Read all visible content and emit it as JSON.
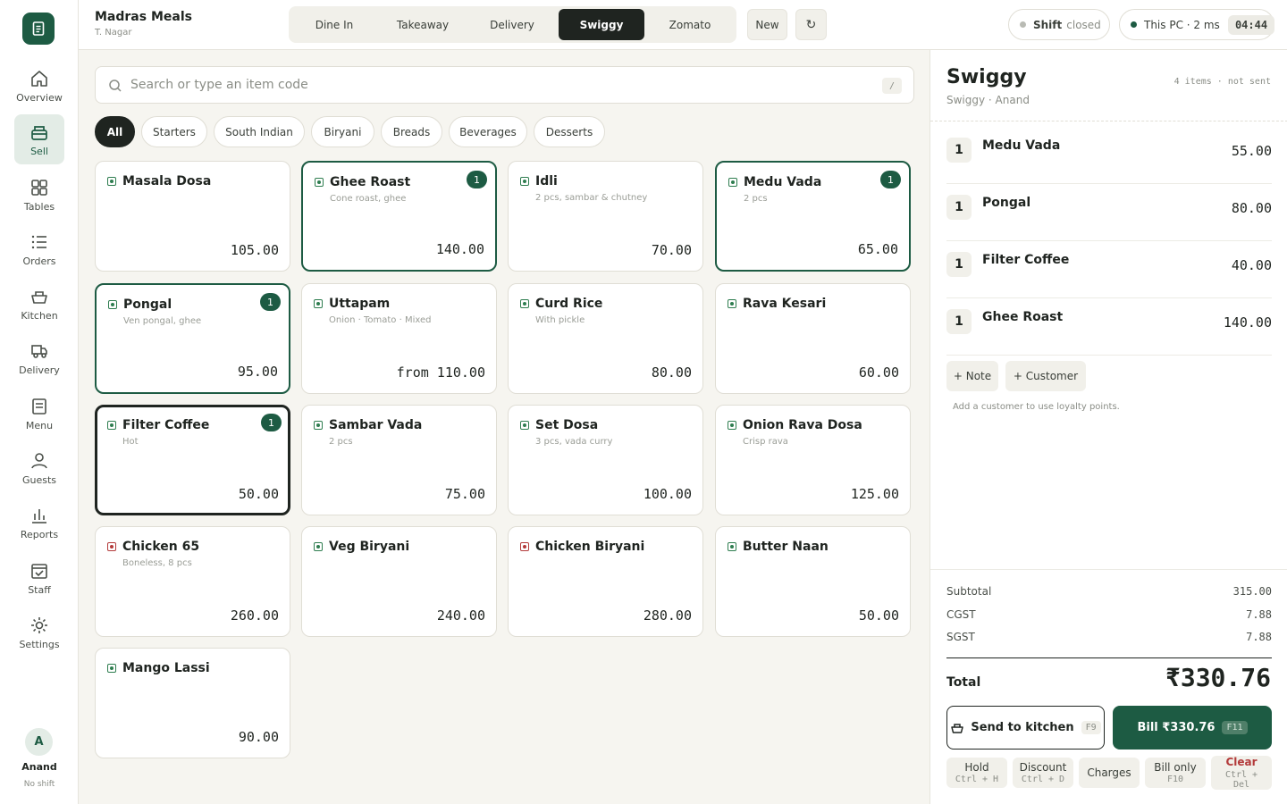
{
  "brand": {
    "name": "Madras Meals",
    "location": "T. Nagar"
  },
  "order_types": [
    "Dine In",
    "Takeaway",
    "Delivery",
    "Swiggy",
    "Zomato"
  ],
  "active_order_type": "Swiggy",
  "new_label": "New",
  "refresh_icon": "↻",
  "shift": {
    "label": "Shift",
    "status": "closed"
  },
  "connection": {
    "label": "This PC · 2 ms"
  },
  "clock": "04:44",
  "nav": [
    {
      "label": "Overview",
      "icon": "home-icon"
    },
    {
      "label": "Sell",
      "icon": "register-icon",
      "active": true
    },
    {
      "label": "Tables",
      "icon": "grid-icon"
    },
    {
      "label": "Orders",
      "icon": "list-icon"
    },
    {
      "label": "Kitchen",
      "icon": "pot-icon"
    },
    {
      "label": "Delivery",
      "icon": "truck-icon"
    },
    {
      "label": "Menu",
      "icon": "menu-icon"
    },
    {
      "label": "Guests",
      "icon": "user-icon"
    },
    {
      "label": "Reports",
      "icon": "chart-icon"
    },
    {
      "label": "Staff",
      "icon": "calendar-icon"
    },
    {
      "label": "Settings",
      "icon": "gear-icon"
    }
  ],
  "user": {
    "initial": "A",
    "name": "Anand",
    "shift": "No shift"
  },
  "search": {
    "placeholder": "Search or type an item code",
    "shortcut": "/"
  },
  "categories": [
    "All",
    "Starters",
    "South Indian",
    "Biryani",
    "Breads",
    "Beverages",
    "Desserts"
  ],
  "active_category": "All",
  "items": [
    {
      "name": "Masala Dosa",
      "desc": "",
      "price": "105.00",
      "veg": true,
      "qty": ""
    },
    {
      "name": "Ghee Roast",
      "desc": "Cone roast, ghee",
      "price": "140.00",
      "veg": true,
      "qty": "1"
    },
    {
      "name": "Idli",
      "desc": "2 pcs, sambar & chutney",
      "price": "70.00",
      "veg": true,
      "qty": ""
    },
    {
      "name": "Medu Vada",
      "desc": "2 pcs",
      "price": "65.00",
      "veg": true,
      "qty": "1"
    },
    {
      "name": "Pongal",
      "desc": "Ven pongal, ghee",
      "price": "95.00",
      "veg": true,
      "qty": "1"
    },
    {
      "name": "Uttapam",
      "desc": "Onion · Tomato · Mixed",
      "price": "from 110.00",
      "veg": true,
      "qty": ""
    },
    {
      "name": "Curd Rice",
      "desc": "With pickle",
      "price": "80.00",
      "veg": true,
      "qty": ""
    },
    {
      "name": "Rava Kesari",
      "desc": "",
      "price": "60.00",
      "veg": true,
      "qty": ""
    },
    {
      "name": "Filter Coffee",
      "desc": "Hot",
      "price": "50.00",
      "veg": true,
      "qty": "1",
      "focused": true
    },
    {
      "name": "Sambar Vada",
      "desc": "2 pcs",
      "price": "75.00",
      "veg": true,
      "qty": ""
    },
    {
      "name": "Set Dosa",
      "desc": "3 pcs, vada curry",
      "price": "100.00",
      "veg": true,
      "qty": ""
    },
    {
      "name": "Onion Rava Dosa",
      "desc": "Crisp rava",
      "price": "125.00",
      "veg": true,
      "qty": ""
    },
    {
      "name": "Chicken 65",
      "desc": "Boneless, 8 pcs",
      "price": "260.00",
      "veg": false,
      "qty": ""
    },
    {
      "name": "Veg Biryani",
      "desc": "",
      "price": "240.00",
      "veg": true,
      "qty": ""
    },
    {
      "name": "Chicken Biryani",
      "desc": "",
      "price": "280.00",
      "veg": false,
      "qty": ""
    },
    {
      "name": "Butter Naan",
      "desc": "",
      "price": "50.00",
      "veg": true,
      "qty": ""
    },
    {
      "name": "Mango Lassi",
      "desc": "",
      "price": "90.00",
      "veg": true,
      "qty": ""
    }
  ],
  "order": {
    "title": "Swiggy",
    "subtitle": "Swiggy · Anand",
    "meta": "4 items · not sent",
    "lines": [
      {
        "qty": "1",
        "name": "Medu Vada",
        "price": "55.00"
      },
      {
        "qty": "1",
        "name": "Pongal",
        "price": "80.00"
      },
      {
        "qty": "1",
        "name": "Filter Coffee",
        "price": "40.00"
      },
      {
        "qty": "1",
        "name": "Ghee Roast",
        "price": "140.00"
      }
    ],
    "note_label": "+ Note",
    "customer_label": "+ Customer",
    "hint": "Add a customer to use loyalty points.",
    "subtotal_label": "Subtotal",
    "subtotal": "315.00",
    "cgst_label": "CGST",
    "cgst": "7.88",
    "sgst_label": "SGST",
    "sgst": "7.88",
    "total_label": "Total",
    "total": "₹330.76",
    "send_label": "Send to kitchen",
    "send_key": "F9",
    "bill_label": "Bill ₹330.76",
    "bill_key": "F11",
    "actions": [
      {
        "label": "Hold",
        "key": "Ctrl + H"
      },
      {
        "label": "Discount",
        "key": "Ctrl + D"
      },
      {
        "label": "Charges",
        "key": ""
      },
      {
        "label": "Bill only",
        "key": "F10"
      },
      {
        "label": "Clear",
        "key": "Ctrl + Del",
        "danger": true
      }
    ]
  },
  "colors": {
    "brand": "#1d5b43",
    "dark": "#1f2420",
    "veg": "#2e7d4f",
    "nonveg": "#b33a3a",
    "danger": "#b33a3a"
  }
}
